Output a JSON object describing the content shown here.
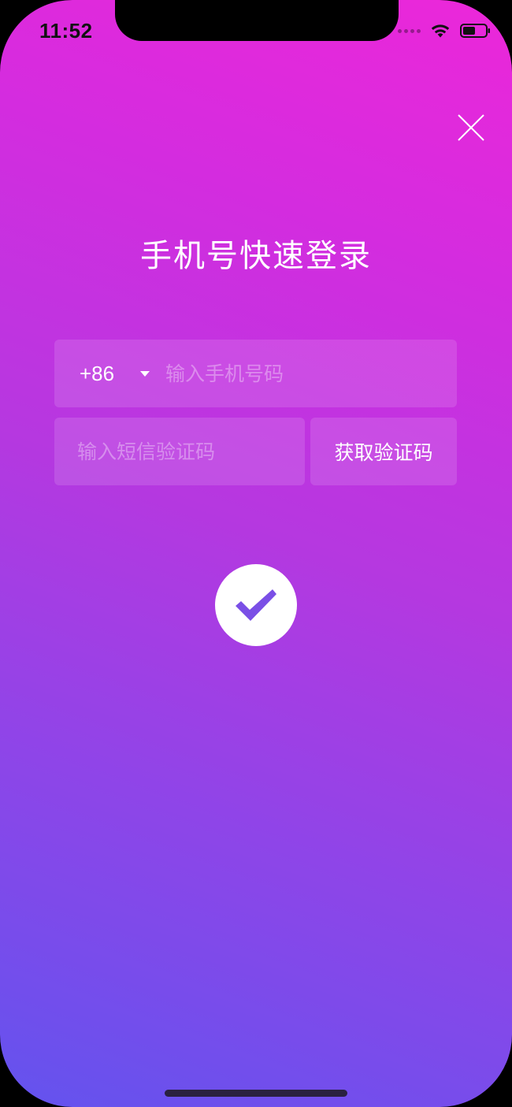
{
  "status_bar": {
    "time": "11:52",
    "icons": [
      "cellular-signal-icon",
      "wifi-icon",
      "battery-icon"
    ]
  },
  "colors": {
    "gradient_top": "#ec27d9",
    "gradient_bottom": "#6353ee",
    "check_color": "#7a4fe6"
  },
  "close_icon": "close-icon",
  "title": "手机号快速登录",
  "phone_field": {
    "country_code": "+86",
    "dropdown_icon": "caret-down-icon",
    "placeholder": "输入手机号码",
    "value": ""
  },
  "code_field": {
    "placeholder": "输入短信验证码",
    "value": ""
  },
  "get_code_button": {
    "label": "获取验证码"
  },
  "confirm_button": {
    "icon": "checkmark-icon"
  }
}
